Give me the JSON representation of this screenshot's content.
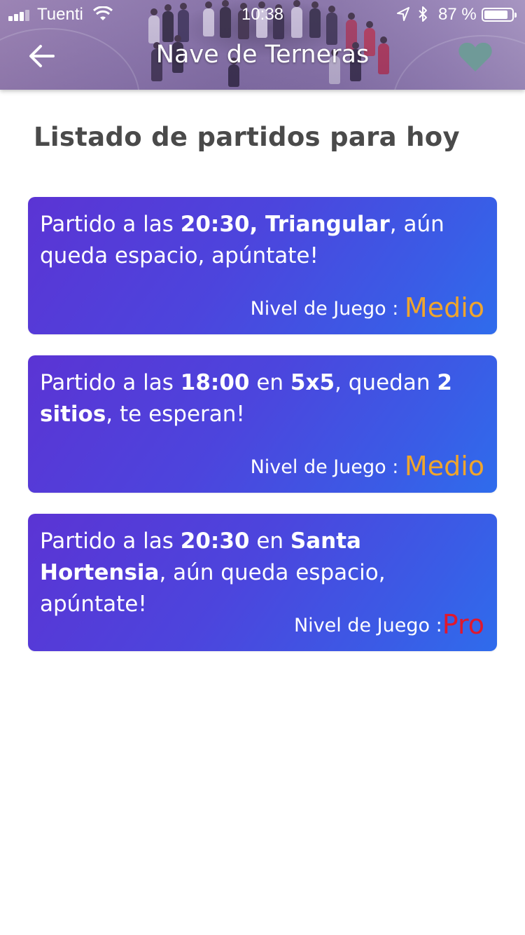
{
  "status_bar": {
    "carrier": "Tuenti",
    "time": "10:38",
    "battery_percent": "87 %",
    "battery_level": 0.87,
    "icons": [
      "signal-icon",
      "wifi-icon",
      "location-icon",
      "bluetooth-icon",
      "battery-icon"
    ]
  },
  "nav": {
    "title": "Nave de Terneras",
    "back_icon": "arrow-left-icon",
    "favorite_icon": "heart-icon"
  },
  "section_title": "Listado de partidos para hoy",
  "colors": {
    "card_gradient_start": "#5b34d4",
    "card_gradient_end": "#2f6cec",
    "level_medio": "#f0a52c",
    "level_pro": "#e0182d",
    "heart": "#6f9a98",
    "title_text": "#4a4a4a"
  },
  "matches": [
    {
      "parts": [
        {
          "t": "Partido a las ",
          "b": false
        },
        {
          "t": "20:30, Triangular",
          "b": true
        },
        {
          "t": ", aún queda espacio, apúntate!",
          "b": false
        }
      ],
      "level_label": "Nivel de Juego : ",
      "level_value": "Medio",
      "level_color": "#f0a52c"
    },
    {
      "parts": [
        {
          "t": "Partido a las ",
          "b": false
        },
        {
          "t": "18:00",
          "b": true
        },
        {
          "t": " en ",
          "b": false
        },
        {
          "t": "5x5",
          "b": true
        },
        {
          "t": ", quedan ",
          "b": false
        },
        {
          "t": "2 sitios",
          "b": true
        },
        {
          "t": ", te esperan!",
          "b": false
        }
      ],
      "level_label": "Nivel de Juego : ",
      "level_value": "Medio",
      "level_color": "#f0a52c"
    },
    {
      "parts": [
        {
          "t": "Partido a las ",
          "b": false
        },
        {
          "t": "20:30",
          "b": true
        },
        {
          "t": " en ",
          "b": false
        },
        {
          "t": "Santa Hortensia",
          "b": true
        },
        {
          "t": ", aún queda espacio, apúntate!",
          "b": false
        }
      ],
      "level_label": "Nivel de Juego :",
      "level_value": "Pro",
      "level_color": "#e0182d"
    }
  ]
}
